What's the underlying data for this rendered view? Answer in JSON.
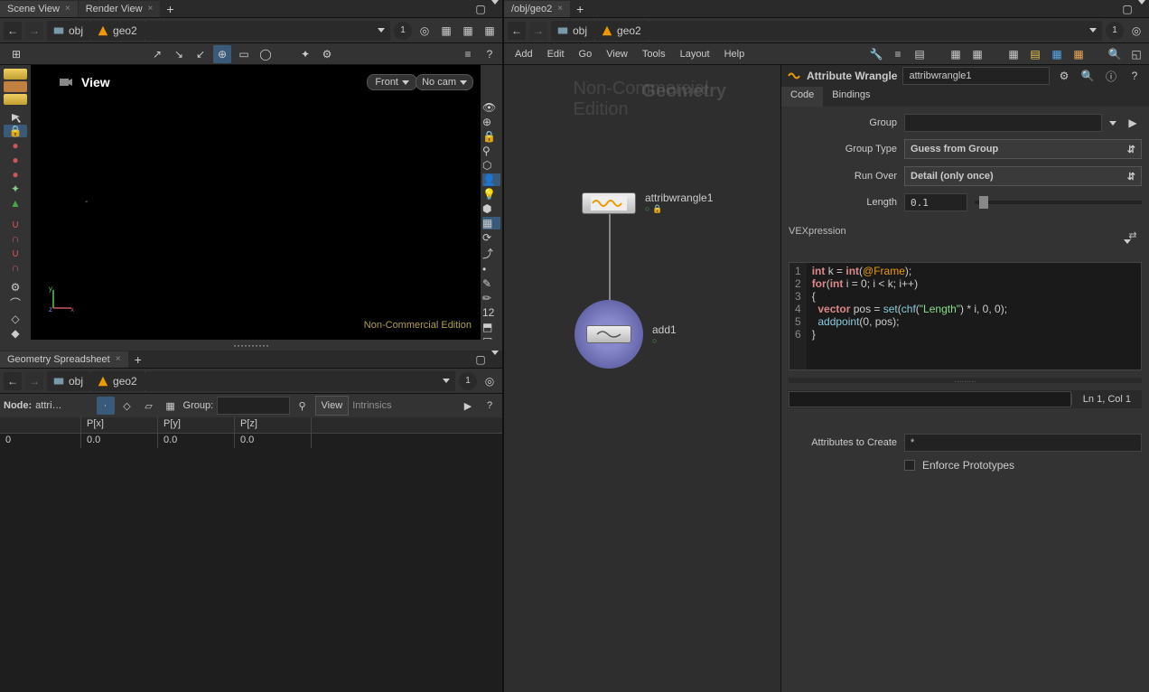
{
  "left": {
    "tabs": [
      "Scene View",
      "Render View"
    ],
    "crumb": {
      "obj": "obj",
      "node": "geo2"
    },
    "nav_count": "1",
    "view_title": "View",
    "cam_dropdown": "Front",
    "nocam": "No cam",
    "footer": "Non-Commercial Edition",
    "lower_tab": "Geometry Spreadsheet",
    "lower_crumb": {
      "obj": "obj",
      "node": "geo2"
    },
    "lower_nav_count": "1",
    "sheet": {
      "node_label": "Node:",
      "node_value": "attri…",
      "group_label": "Group:",
      "view": "View",
      "intrinsics": "Intrinsics",
      "headers": [
        "",
        "P[x]",
        "P[y]",
        "P[z]"
      ],
      "rows": [
        [
          "0",
          "0.0",
          "0.0",
          "0.0"
        ]
      ]
    }
  },
  "right": {
    "tab": "/obj/geo2",
    "crumb": {
      "obj": "obj",
      "node": "geo2"
    },
    "nav_count": "1",
    "menubar": [
      "Add",
      "Edit",
      "Go",
      "View",
      "Tools",
      "Layout",
      "Help"
    ],
    "watermark1": "Non-Commercial Edition",
    "watermark2": "Geometry",
    "nodes": {
      "wrangle": "attribwrangle1",
      "add": "add1"
    },
    "parm": {
      "node_type": "Attribute Wrangle",
      "node_name": "attribwrangle1",
      "tabs": [
        "Code",
        "Bindings"
      ],
      "group_label": "Group",
      "group_value": "",
      "grouptype_label": "Group Type",
      "grouptype_value": "Guess from Group",
      "runover_label": "Run Over",
      "runover_value": "Detail (only once)",
      "length_label": "Length",
      "length_value": "0.1",
      "vex_label": "VEXpression",
      "code_lines": [
        {
          "n": 1,
          "html": "<span class='kw'>int</span> k = <span class='kw'>int</span>(<span class='at'>@Frame</span>);"
        },
        {
          "n": 2,
          "html": "<span class='kw'>for</span>(<span class='kw'>int</span> i = 0; i &lt; k; i++)"
        },
        {
          "n": 3,
          "html": "{"
        },
        {
          "n": 4,
          "html": "&nbsp;&nbsp;<span class='kw'>vector</span> pos = <span class='fn'>set</span>(<span class='fn'>chf</span>(<span class='str'>\"Length\"</span>) * i, 0, 0);"
        },
        {
          "n": 5,
          "html": "&nbsp;&nbsp;<span class='fn'>addpoint</span>(0, pos);"
        },
        {
          "n": 6,
          "html": "}"
        }
      ],
      "cursor": "Ln 1, Col 1",
      "attrs_label": "Attributes to Create",
      "attrs_value": "*",
      "enforce_label": "Enforce Prototypes"
    }
  }
}
